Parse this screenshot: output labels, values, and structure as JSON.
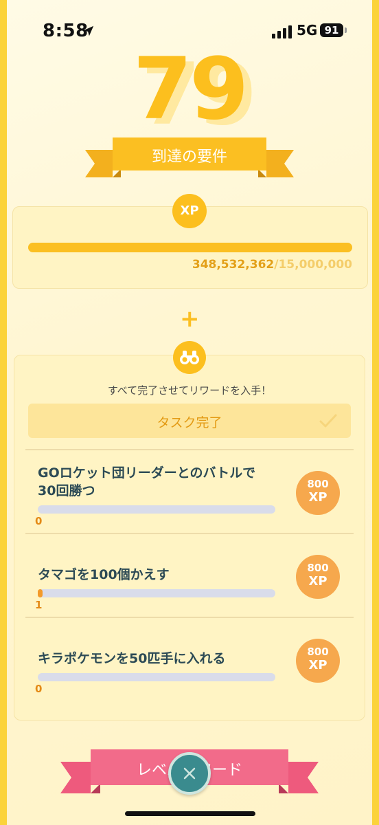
{
  "status_bar": {
    "time": "8:58",
    "network": "5G",
    "battery": "91"
  },
  "level": "79",
  "requirements_ribbon": "到達の要件",
  "xp": {
    "badge": "XP",
    "current": "348,532,362",
    "separator": "/",
    "goal": "15,000,000",
    "progress_fraction": 1.0
  },
  "plus": "+",
  "tasks": {
    "instruction": "すべて完了させてリワードを入手！",
    "complete_label": "タスク完了",
    "items": [
      {
        "title": "GOロケット団リーダーとのバトルで30回勝つ",
        "count": "0",
        "progress": 0.0,
        "reward_amount": "800",
        "reward_unit": "XP"
      },
      {
        "title": "タマゴを100個かえす",
        "count": "1",
        "progress": 0.01,
        "reward_amount": "800",
        "reward_unit": "XP"
      },
      {
        "title": "キラポケモンを50匹手に入れる",
        "count": "0",
        "progress": 0.0,
        "reward_amount": "800",
        "reward_unit": "XP"
      }
    ]
  },
  "reward_ribbon": "レベルリワード",
  "colors": {
    "gold": "#fcbf1e",
    "orange": "#f6a84d",
    "pink": "#f26b8a",
    "teal": "#3a8b8e"
  },
  "icons": {
    "binoculars": "binoculars-icon",
    "close": "close-icon",
    "check": "check-icon",
    "location": "location-arrow-icon"
  }
}
